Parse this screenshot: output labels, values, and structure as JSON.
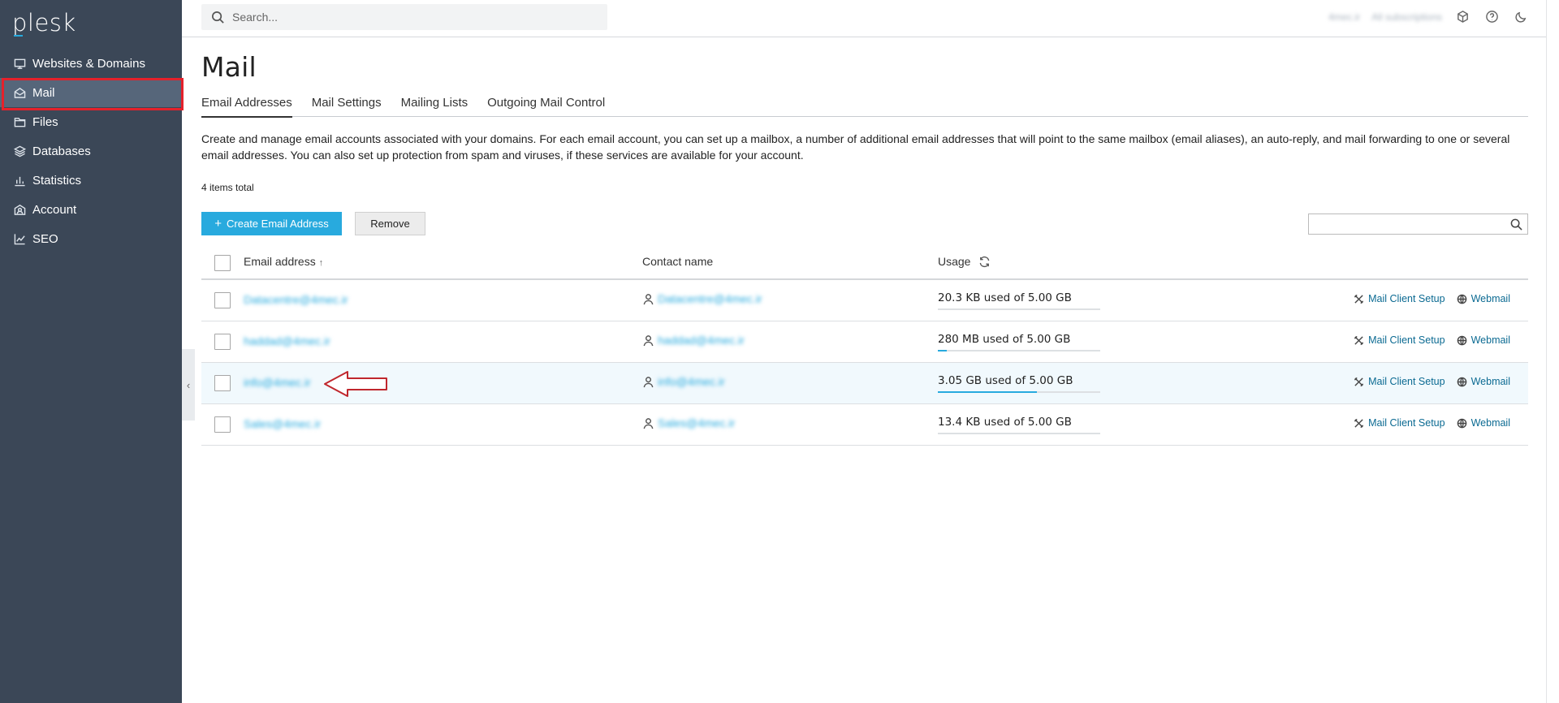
{
  "sidebar": {
    "logo": "plesk",
    "items": [
      {
        "label": "Websites & Domains",
        "icon": "monitor-icon"
      },
      {
        "label": "Mail",
        "icon": "mail-icon",
        "active": true
      },
      {
        "label": "Files",
        "icon": "folder-icon"
      },
      {
        "label": "Databases",
        "icon": "layers-icon"
      },
      {
        "label": "Statistics",
        "icon": "bar-chart-icon"
      },
      {
        "label": "Account",
        "icon": "account-icon"
      },
      {
        "label": "SEO",
        "icon": "trend-icon"
      }
    ],
    "collapse_glyph": "‹"
  },
  "topbar": {
    "search_placeholder": "Search...",
    "user": "4mec.ir",
    "subscriptions": "All subscriptions"
  },
  "main": {
    "title": "Mail",
    "tabs": [
      {
        "label": "Email Addresses",
        "active": true
      },
      {
        "label": "Mail Settings"
      },
      {
        "label": "Mailing Lists"
      },
      {
        "label": "Outgoing Mail Control"
      }
    ],
    "description": "Create and manage email accounts associated with your domains. For each email account, you can set up a mailbox, a number of additional email addresses that will point to the same mailbox (email aliases), an auto-reply, and mail forwarding to one or several email addresses. You can also set up protection from spam and viruses, if these services are available for your account.",
    "items_total": "4 items total",
    "create_button": "Create Email Address",
    "remove_button": "Remove"
  },
  "table": {
    "headers": {
      "email": "Email address",
      "sort_glyph": "↑",
      "contact": "Contact name",
      "usage": "Usage"
    },
    "action_setup": "Mail Client Setup",
    "action_webmail": "Webmail",
    "rows": [
      {
        "email": "Datacentre@4mec.ir",
        "contact": "Datacentre@4mec.ir",
        "usage": "20.3 KB used of 5.00 GB",
        "usage_fraction": 0.0
      },
      {
        "email": "haddad@4mec.ir",
        "contact": "haddad@4mec.ir",
        "usage": "280 MB used of 5.00 GB",
        "usage_fraction": 0.055
      },
      {
        "email": "info@4mec.ir",
        "contact": "info@4mec.ir",
        "usage": "3.05 GB used of 5.00 GB",
        "usage_fraction": 0.61,
        "highlight": true
      },
      {
        "email": "Sales@4mec.ir",
        "contact": "Sales@4mec.ir",
        "usage": "13.4 KB used of 5.00 GB",
        "usage_fraction": 0.0
      }
    ]
  },
  "colors": {
    "sidebar_bg": "#3b4757",
    "accent": "#28aade",
    "annotation": "#c0272d"
  }
}
